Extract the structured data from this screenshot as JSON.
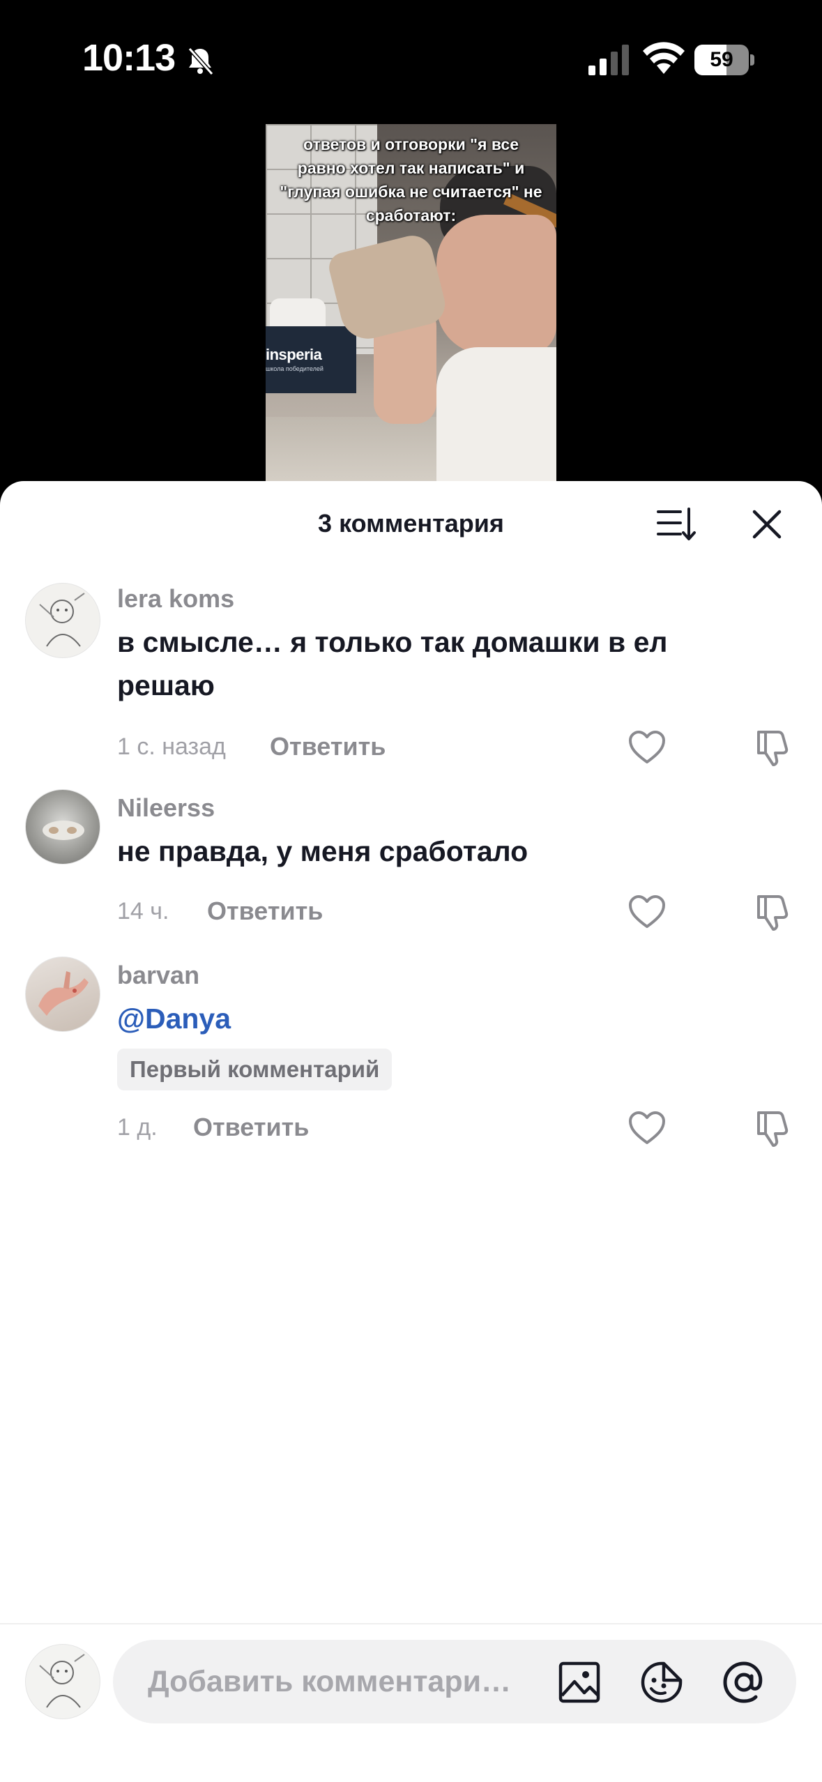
{
  "status_bar": {
    "time": "10:13",
    "battery": "59",
    "battery_level": 0.59
  },
  "video": {
    "overlay_lines": [
      "ответов и отговорки \"я все",
      "равно хотел так написать\" и",
      "\"глупая ошибка не считается\" не",
      "сработают:"
    ],
    "brand_name": "insperia",
    "brand_sub": "школа победителей"
  },
  "sheet": {
    "title": "3 комментария"
  },
  "comments": [
    {
      "user": "lera koms",
      "text": "в смысле… я только так домашки в ел решаю",
      "time": "1 с. назад",
      "reply": "Ответить"
    },
    {
      "user": "Nileerss",
      "text": "не правда, у меня сработало",
      "time": "14 ч.",
      "reply": "Ответить"
    },
    {
      "user": "barvan",
      "mention": "@Danya",
      "badge": "Первый комментарий",
      "time": "1 д.",
      "reply": "Ответить"
    }
  ],
  "composer": {
    "placeholder": "Добавить комментари…",
    "icons": [
      "image-icon",
      "sticker-icon",
      "mention-icon"
    ]
  },
  "colors": {
    "mention": "#2b5db9",
    "primary_text": "#161823",
    "secondary_text": "#8a8a8f"
  }
}
